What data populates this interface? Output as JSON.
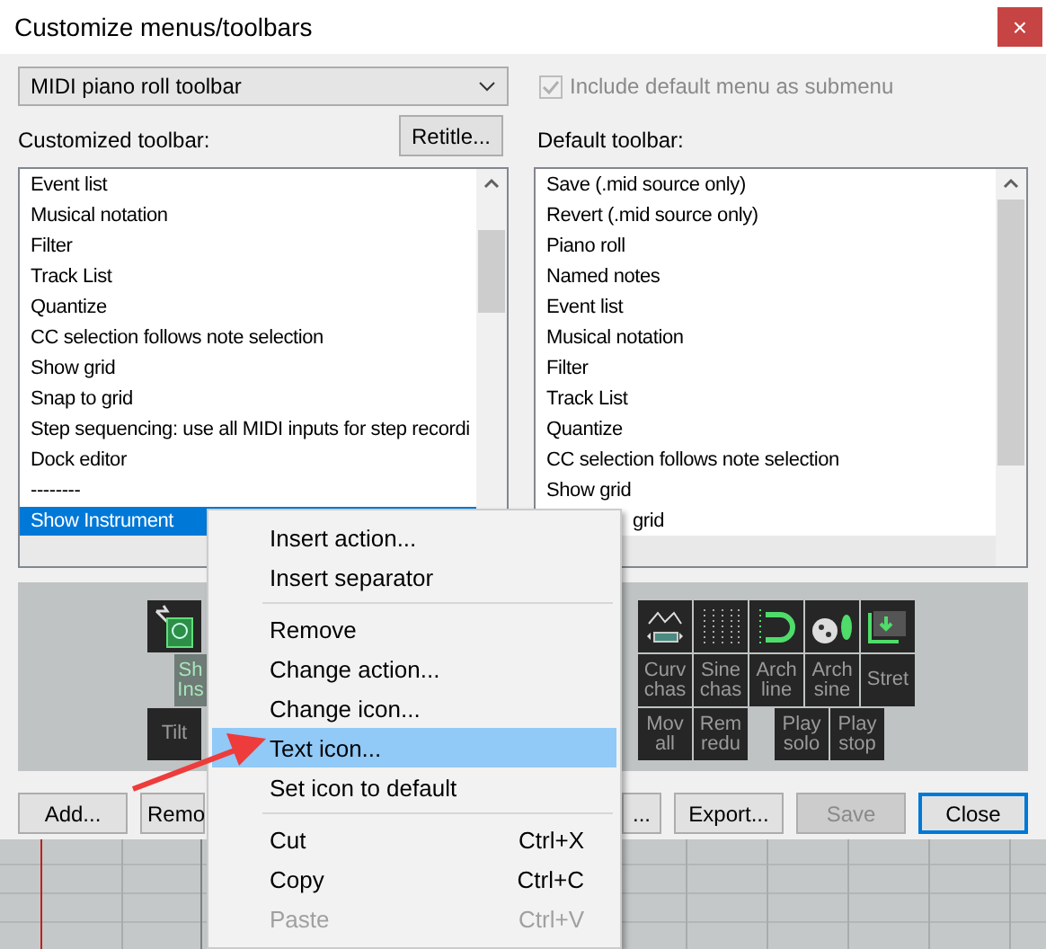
{
  "window": {
    "title": "Customize menus/toolbars",
    "close": "×"
  },
  "menu_select": {
    "value": "MIDI piano roll toolbar"
  },
  "include_default": {
    "label": "Include default menu as submenu",
    "checked": true,
    "disabled": true
  },
  "customized": {
    "label": "Customized toolbar:",
    "retitle": "Retitle...",
    "items": [
      {
        "label": "Event list",
        "selected": false
      },
      {
        "label": "Musical notation",
        "selected": false
      },
      {
        "label": "Filter",
        "selected": false
      },
      {
        "label": "Track List",
        "selected": false
      },
      {
        "label": "Quantize",
        "selected": false
      },
      {
        "label": "CC selection follows note selection",
        "selected": false
      },
      {
        "label": "Show grid",
        "selected": false
      },
      {
        "label": "Snap to grid",
        "selected": false
      },
      {
        "label": "Step sequencing: use all MIDI inputs for step recordi",
        "selected": false
      },
      {
        "label": "Dock editor",
        "selected": false
      },
      {
        "label": "--------",
        "selected": false
      },
      {
        "label": "Show Instrument",
        "selected": true
      }
    ]
  },
  "default": {
    "label": "Default toolbar:",
    "items": [
      {
        "label": "Save (.mid source only)",
        "selected": false
      },
      {
        "label": "Revert (.mid source only)",
        "selected": false
      },
      {
        "label": "Piano roll",
        "selected": false
      },
      {
        "label": "Named notes",
        "selected": false
      },
      {
        "label": "Event list",
        "selected": false
      },
      {
        "label": "Musical notation",
        "selected": false
      },
      {
        "label": "Filter",
        "selected": false
      },
      {
        "label": "Track List",
        "selected": false
      },
      {
        "label": "Quantize",
        "selected": false
      },
      {
        "label": "CC selection follows note selection",
        "selected": false
      },
      {
        "label": "Show grid",
        "selected": false
      },
      {
        "label": "grid",
        "selected": false
      }
    ]
  },
  "preview": {
    "left_tiles": [
      {
        "kind": "icon",
        "selected": false
      },
      {
        "kind": "text",
        "lines": [
          "Sh",
          "Ins"
        ],
        "selected": true
      },
      {
        "kind": "text",
        "lines": [
          "Tilt"
        ],
        "selected": false
      }
    ],
    "right_rows": [
      [
        {
          "kind": "icon",
          "selected": false
        },
        {
          "kind": "icon",
          "selected": false
        },
        {
          "kind": "icon",
          "selected": false
        },
        {
          "kind": "icon",
          "selected": false
        },
        {
          "kind": "icon",
          "selected": false
        }
      ],
      [
        {
          "kind": "text",
          "lines": [
            "Curv",
            "chas"
          ],
          "selected": false
        },
        {
          "kind": "text",
          "lines": [
            "Sine",
            "chas"
          ],
          "selected": false
        },
        {
          "kind": "text",
          "lines": [
            "Arch",
            "line"
          ],
          "selected": false
        },
        {
          "kind": "text",
          "lines": [
            "Arch",
            "sine"
          ],
          "selected": false
        },
        {
          "kind": "text",
          "lines": [
            "Stret"
          ],
          "selected": false
        }
      ],
      [
        {
          "kind": "text",
          "lines": [
            "Mov",
            "all"
          ],
          "selected": false
        },
        {
          "kind": "text",
          "lines": [
            "Rem",
            "redu"
          ],
          "selected": false
        },
        {
          "kind": "gap"
        },
        {
          "kind": "text",
          "lines": [
            "Play",
            "solo"
          ],
          "selected": false
        },
        {
          "kind": "text",
          "lines": [
            "Play",
            "stop"
          ],
          "selected": false
        }
      ]
    ]
  },
  "buttons": [
    {
      "label": "Add...",
      "disabled": false,
      "focused": false
    },
    {
      "label": "Remo",
      "disabled": false,
      "focused": false
    },
    {
      "label": "...",
      "disabled": false,
      "focused": false
    },
    {
      "label": "Export...",
      "disabled": false,
      "focused": false
    },
    {
      "label": "Save",
      "disabled": true,
      "focused": false
    },
    {
      "label": "Close",
      "disabled": false,
      "focused": true
    }
  ],
  "context_menu": {
    "items": [
      {
        "kind": "item",
        "label": "Insert action...",
        "selected": false,
        "disabled": false
      },
      {
        "kind": "item",
        "label": "Insert separator",
        "selected": false,
        "disabled": false
      },
      {
        "kind": "separator"
      },
      {
        "kind": "item",
        "label": "Remove",
        "selected": false,
        "disabled": false
      },
      {
        "kind": "item",
        "label": "Change action...",
        "selected": false,
        "disabled": false
      },
      {
        "kind": "item",
        "label": "Change icon...",
        "selected": false,
        "disabled": false
      },
      {
        "kind": "item",
        "label": "Text icon...",
        "selected": true,
        "disabled": false
      },
      {
        "kind": "item",
        "label": "Set icon to default",
        "selected": false,
        "disabled": false
      },
      {
        "kind": "separator"
      },
      {
        "kind": "item",
        "label": "Cut",
        "shortcut": "Ctrl+X",
        "selected": false,
        "disabled": false
      },
      {
        "kind": "item",
        "label": "Copy",
        "shortcut": "Ctrl+C",
        "selected": false,
        "disabled": false
      },
      {
        "kind": "item",
        "label": "Paste",
        "shortcut": "Ctrl+V",
        "selected": false,
        "disabled": true
      }
    ]
  }
}
